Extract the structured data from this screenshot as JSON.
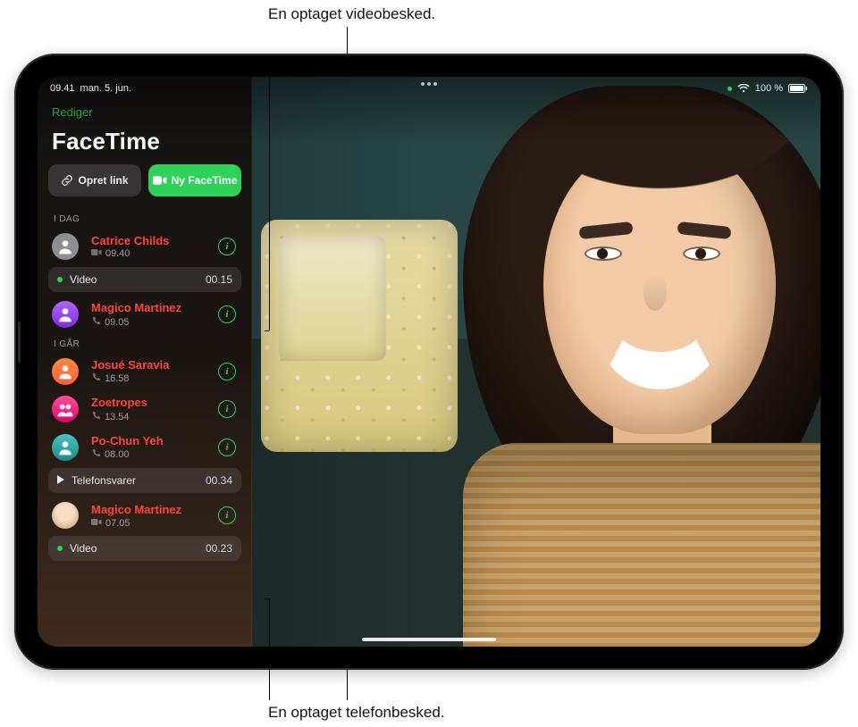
{
  "callouts": {
    "top": "En optaget videobesked.",
    "bottom": "En optaget telefonbesked."
  },
  "statusbar": {
    "time": "09.41",
    "date": "man. 5. jun.",
    "battery": "100 %"
  },
  "sidebar": {
    "edit": "Rediger",
    "title": "FaceTime",
    "createLink": "Opret link",
    "newFaceTime": "Ny FaceTime",
    "sections": [
      {
        "header": "I DAG",
        "items": [
          {
            "name": "Catrice Childs",
            "time": "09.40",
            "type": "video",
            "message": {
              "kind": "video",
              "label": "Video",
              "duration": "00.15",
              "unread": true
            }
          },
          {
            "name": "Magico Martinez",
            "time": "09.05",
            "type": "audio"
          }
        ]
      },
      {
        "header": "I GÅR",
        "items": [
          {
            "name": "Josué Saravia",
            "time": "16.58",
            "type": "audio"
          },
          {
            "name": "Zoetropes",
            "time": "13.54",
            "type": "audio"
          },
          {
            "name": "Po-Chun Yeh",
            "time": "08.00",
            "type": "audio",
            "message": {
              "kind": "voicemail",
              "label": "Telefonsvarer",
              "duration": "00.34",
              "unread": false
            }
          },
          {
            "name": "Magico Martinez",
            "time": "07.05",
            "type": "video",
            "message": {
              "kind": "video",
              "label": "Video",
              "duration": "00.23",
              "unread": true
            }
          }
        ]
      }
    ]
  },
  "icons": {
    "info": "i"
  }
}
